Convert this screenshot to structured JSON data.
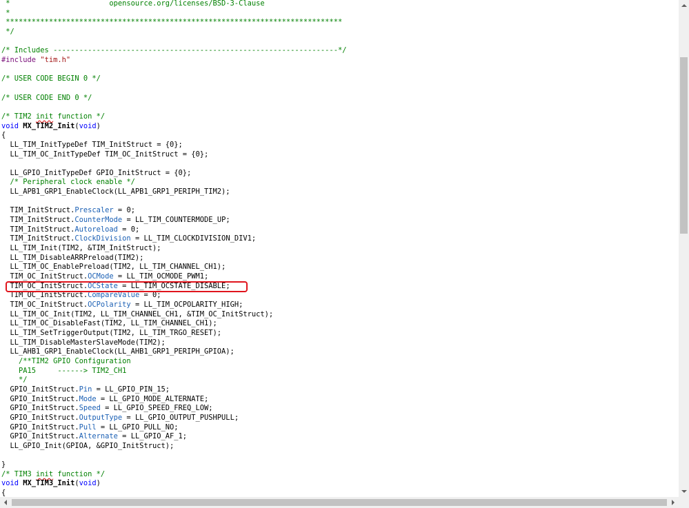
{
  "editor": {
    "lines": [
      [
        {
          "t": " *                       opensource.org/licenses/BSD-3-Clause",
          "c": "c"
        }
      ],
      [
        {
          "t": " *",
          "c": "c"
        }
      ],
      [
        {
          "t": " ******************************************************************************",
          "c": "c"
        }
      ],
      [
        {
          "t": " */",
          "c": "c"
        }
      ],
      [
        {
          "t": "",
          "c": ""
        }
      ],
      [
        {
          "t": "/* Includes ------------------------------------------------------------------*/",
          "c": "c"
        }
      ],
      [
        {
          "t": "#include ",
          "c": "pp"
        },
        {
          "t": "\"tim.h\"",
          "c": "s"
        }
      ],
      [
        {
          "t": "",
          "c": ""
        }
      ],
      [
        {
          "t": "/* USER CODE BEGIN 0 */",
          "c": "c"
        }
      ],
      [
        {
          "t": "",
          "c": ""
        }
      ],
      [
        {
          "t": "/* USER CODE END 0 */",
          "c": "c"
        }
      ],
      [
        {
          "t": "",
          "c": ""
        }
      ],
      [
        {
          "t": "/* TIM2 ",
          "c": "c"
        },
        {
          "t": "init",
          "c": "c squiggle"
        },
        {
          "t": " function */",
          "c": "c"
        }
      ],
      [
        {
          "t": "void",
          "c": "k"
        },
        {
          "t": " ",
          "c": ""
        },
        {
          "t": "MX_TIM2_Init",
          "c": "fn"
        },
        {
          "t": "(",
          "c": ""
        },
        {
          "t": "void",
          "c": "k"
        },
        {
          "t": ")",
          "c": ""
        }
      ],
      [
        {
          "t": "{",
          "c": ""
        }
      ],
      [
        {
          "t": "  LL_TIM_InitTypeDef TIM_InitStruct = {0};",
          "c": ""
        }
      ],
      [
        {
          "t": "  LL_TIM_OC_InitTypeDef TIM_OC_InitStruct = {0};",
          "c": ""
        }
      ],
      [
        {
          "t": "",
          "c": ""
        }
      ],
      [
        {
          "t": "  LL_GPIO_InitTypeDef GPIO_InitStruct = {0};",
          "c": ""
        }
      ],
      [
        {
          "t": "  /* Peripheral clock enable */",
          "c": "c"
        }
      ],
      [
        {
          "t": "  LL_APB1_GRP1_EnableClock(LL_APB1_GRP1_PERIPH_TIM2);",
          "c": ""
        }
      ],
      [
        {
          "t": "",
          "c": ""
        }
      ],
      [
        {
          "t": "  TIM_InitStruct.",
          "c": ""
        },
        {
          "t": "Prescaler",
          "c": "m"
        },
        {
          "t": " = 0;",
          "c": ""
        }
      ],
      [
        {
          "t": "  TIM_InitStruct.",
          "c": ""
        },
        {
          "t": "CounterMode",
          "c": "m"
        },
        {
          "t": " = LL_TIM_COUNTERMODE_UP;",
          "c": ""
        }
      ],
      [
        {
          "t": "  TIM_InitStruct.",
          "c": ""
        },
        {
          "t": "Autoreload",
          "c": "m"
        },
        {
          "t": " = 0;",
          "c": ""
        }
      ],
      [
        {
          "t": "  TIM_InitStruct.",
          "c": ""
        },
        {
          "t": "ClockDivision",
          "c": "m"
        },
        {
          "t": " = LL_TIM_CLOCKDIVISION_DIV1;",
          "c": ""
        }
      ],
      [
        {
          "t": "  LL_TIM_Init(TIM2, &TIM_InitStruct);",
          "c": ""
        }
      ],
      [
        {
          "t": "  LL_TIM_DisableARRPreload(TIM2);",
          "c": ""
        }
      ],
      [
        {
          "t": "  LL_TIM_OC_EnablePreload(TIM2, LL_TIM_CHANNEL_CH1);",
          "c": ""
        }
      ],
      [
        {
          "t": "  TIM_OC_InitStruct.",
          "c": ""
        },
        {
          "t": "OCMode",
          "c": "m"
        },
        {
          "t": " = LL_TIM_OCMODE_PWM1;",
          "c": ""
        }
      ],
      [
        {
          "t": "  TIM_OC_InitStruct.",
          "c": ""
        },
        {
          "t": "OCState",
          "c": "m"
        },
        {
          "t": " = LL_TIM_OCSTATE_DISABLE;",
          "c": ""
        }
      ],
      [
        {
          "t": "  TIM_OC_InitStruct.",
          "c": ""
        },
        {
          "t": "CompareValue",
          "c": "m"
        },
        {
          "t": " = 0;",
          "c": ""
        }
      ],
      [
        {
          "t": "  TIM_OC_InitStruct.",
          "c": ""
        },
        {
          "t": "OCPolarity",
          "c": "m"
        },
        {
          "t": " = LL_TIM_OCPOLARITY_HIGH;",
          "c": ""
        }
      ],
      [
        {
          "t": "  LL_TIM_OC_Init(TIM2, LL_TIM_CHANNEL_CH1, &TIM_OC_InitStruct);",
          "c": ""
        }
      ],
      [
        {
          "t": "  LL_TIM_OC_DisableFast(TIM2, LL_TIM_CHANNEL_CH1);",
          "c": ""
        }
      ],
      [
        {
          "t": "  LL_TIM_SetTriggerOutput(TIM2, LL_TIM_TRGO_RESET);",
          "c": ""
        }
      ],
      [
        {
          "t": "  LL_TIM_DisableMasterSlaveMode(TIM2);",
          "c": ""
        }
      ],
      [
        {
          "t": "  LL_AHB1_GRP1_EnableClock(LL_AHB1_GRP1_PERIPH_GPIOA);",
          "c": ""
        }
      ],
      [
        {
          "t": "    /**TIM2 GPIO Configuration",
          "c": "c"
        }
      ],
      [
        {
          "t": "    PA15     ------> TIM2_CH1",
          "c": "c"
        }
      ],
      [
        {
          "t": "    */",
          "c": "c"
        }
      ],
      [
        {
          "t": "  GPIO_InitStruct.",
          "c": ""
        },
        {
          "t": "Pin",
          "c": "m"
        },
        {
          "t": " = LL_GPIO_PIN_15;",
          "c": ""
        }
      ],
      [
        {
          "t": "  GPIO_InitStruct.",
          "c": ""
        },
        {
          "t": "Mode",
          "c": "m"
        },
        {
          "t": " = LL_GPIO_MODE_ALTERNATE;",
          "c": ""
        }
      ],
      [
        {
          "t": "  GPIO_InitStruct.",
          "c": ""
        },
        {
          "t": "Speed",
          "c": "m"
        },
        {
          "t": " = LL_GPIO_SPEED_FREQ_LOW;",
          "c": ""
        }
      ],
      [
        {
          "t": "  GPIO_InitStruct.",
          "c": ""
        },
        {
          "t": "OutputType",
          "c": "m"
        },
        {
          "t": " = LL_GPIO_OUTPUT_PUSHPULL;",
          "c": ""
        }
      ],
      [
        {
          "t": "  GPIO_InitStruct.",
          "c": ""
        },
        {
          "t": "Pull",
          "c": "m"
        },
        {
          "t": " = LL_GPIO_PULL_NO;",
          "c": ""
        }
      ],
      [
        {
          "t": "  GPIO_InitStruct.",
          "c": ""
        },
        {
          "t": "Alternate",
          "c": "m"
        },
        {
          "t": " = LL_GPIO_AF_1;",
          "c": ""
        }
      ],
      [
        {
          "t": "  LL_GPIO_Init(GPIOA, &GPIO_InitStruct);",
          "c": ""
        }
      ],
      [
        {
          "t": "",
          "c": ""
        }
      ],
      [
        {
          "t": "}",
          "c": ""
        }
      ],
      [
        {
          "t": "/* TIM3 ",
          "c": "c"
        },
        {
          "t": "init",
          "c": "c squiggle"
        },
        {
          "t": " function */",
          "c": "c"
        }
      ],
      [
        {
          "t": "void",
          "c": "k"
        },
        {
          "t": " ",
          "c": ""
        },
        {
          "t": "MX_TIM3_Init",
          "c": "fn"
        },
        {
          "t": "(",
          "c": ""
        },
        {
          "t": "void",
          "c": "k"
        },
        {
          "t": ")",
          "c": ""
        }
      ],
      [
        {
          "t": "{",
          "c": ""
        }
      ]
    ],
    "highlighted_line_index": 30
  },
  "colors": {
    "comment": "#008000",
    "string": "#a31515",
    "keyword": "#0000ff",
    "member": "#1a5fb4",
    "highlight_border": "#e0141c",
    "scrollbar_track": "#f0f0f0",
    "scrollbar_thumb": "#c2c2c2"
  },
  "icons": {
    "scroll_up": "triangle-up-icon",
    "scroll_down": "triangle-down-icon",
    "scroll_left": "triangle-left-icon",
    "scroll_right": "triangle-right-icon"
  }
}
